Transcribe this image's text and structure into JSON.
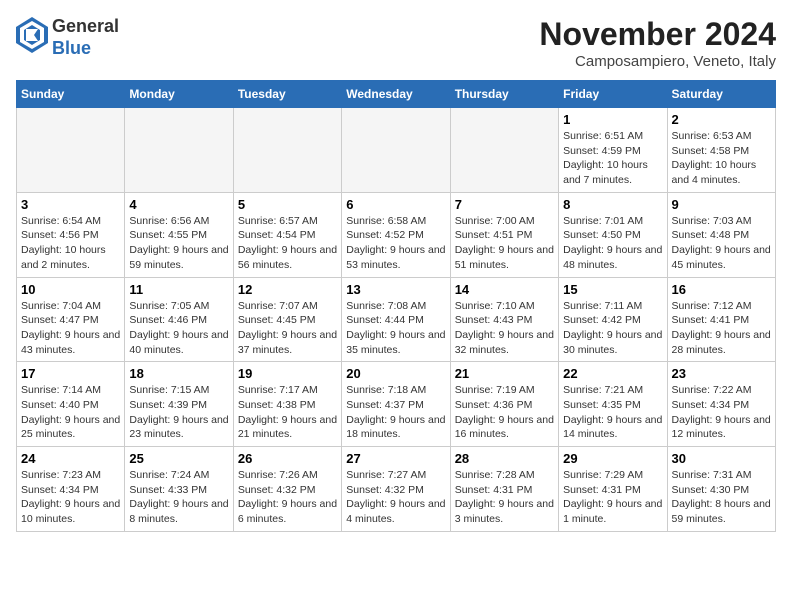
{
  "header": {
    "logo_line1": "General",
    "logo_line2": "Blue",
    "month_title": "November 2024",
    "location": "Camposampiero, Veneto, Italy"
  },
  "days_of_week": [
    "Sunday",
    "Monday",
    "Tuesday",
    "Wednesday",
    "Thursday",
    "Friday",
    "Saturday"
  ],
  "weeks": [
    [
      {
        "day": "",
        "info": ""
      },
      {
        "day": "",
        "info": ""
      },
      {
        "day": "",
        "info": ""
      },
      {
        "day": "",
        "info": ""
      },
      {
        "day": "",
        "info": ""
      },
      {
        "day": "1",
        "info": "Sunrise: 6:51 AM\nSunset: 4:59 PM\nDaylight: 10 hours and 7 minutes."
      },
      {
        "day": "2",
        "info": "Sunrise: 6:53 AM\nSunset: 4:58 PM\nDaylight: 10 hours and 4 minutes."
      }
    ],
    [
      {
        "day": "3",
        "info": "Sunrise: 6:54 AM\nSunset: 4:56 PM\nDaylight: 10 hours and 2 minutes."
      },
      {
        "day": "4",
        "info": "Sunrise: 6:56 AM\nSunset: 4:55 PM\nDaylight: 9 hours and 59 minutes."
      },
      {
        "day": "5",
        "info": "Sunrise: 6:57 AM\nSunset: 4:54 PM\nDaylight: 9 hours and 56 minutes."
      },
      {
        "day": "6",
        "info": "Sunrise: 6:58 AM\nSunset: 4:52 PM\nDaylight: 9 hours and 53 minutes."
      },
      {
        "day": "7",
        "info": "Sunrise: 7:00 AM\nSunset: 4:51 PM\nDaylight: 9 hours and 51 minutes."
      },
      {
        "day": "8",
        "info": "Sunrise: 7:01 AM\nSunset: 4:50 PM\nDaylight: 9 hours and 48 minutes."
      },
      {
        "day": "9",
        "info": "Sunrise: 7:03 AM\nSunset: 4:48 PM\nDaylight: 9 hours and 45 minutes."
      }
    ],
    [
      {
        "day": "10",
        "info": "Sunrise: 7:04 AM\nSunset: 4:47 PM\nDaylight: 9 hours and 43 minutes."
      },
      {
        "day": "11",
        "info": "Sunrise: 7:05 AM\nSunset: 4:46 PM\nDaylight: 9 hours and 40 minutes."
      },
      {
        "day": "12",
        "info": "Sunrise: 7:07 AM\nSunset: 4:45 PM\nDaylight: 9 hours and 37 minutes."
      },
      {
        "day": "13",
        "info": "Sunrise: 7:08 AM\nSunset: 4:44 PM\nDaylight: 9 hours and 35 minutes."
      },
      {
        "day": "14",
        "info": "Sunrise: 7:10 AM\nSunset: 4:43 PM\nDaylight: 9 hours and 32 minutes."
      },
      {
        "day": "15",
        "info": "Sunrise: 7:11 AM\nSunset: 4:42 PM\nDaylight: 9 hours and 30 minutes."
      },
      {
        "day": "16",
        "info": "Sunrise: 7:12 AM\nSunset: 4:41 PM\nDaylight: 9 hours and 28 minutes."
      }
    ],
    [
      {
        "day": "17",
        "info": "Sunrise: 7:14 AM\nSunset: 4:40 PM\nDaylight: 9 hours and 25 minutes."
      },
      {
        "day": "18",
        "info": "Sunrise: 7:15 AM\nSunset: 4:39 PM\nDaylight: 9 hours and 23 minutes."
      },
      {
        "day": "19",
        "info": "Sunrise: 7:17 AM\nSunset: 4:38 PM\nDaylight: 9 hours and 21 minutes."
      },
      {
        "day": "20",
        "info": "Sunrise: 7:18 AM\nSunset: 4:37 PM\nDaylight: 9 hours and 18 minutes."
      },
      {
        "day": "21",
        "info": "Sunrise: 7:19 AM\nSunset: 4:36 PM\nDaylight: 9 hours and 16 minutes."
      },
      {
        "day": "22",
        "info": "Sunrise: 7:21 AM\nSunset: 4:35 PM\nDaylight: 9 hours and 14 minutes."
      },
      {
        "day": "23",
        "info": "Sunrise: 7:22 AM\nSunset: 4:34 PM\nDaylight: 9 hours and 12 minutes."
      }
    ],
    [
      {
        "day": "24",
        "info": "Sunrise: 7:23 AM\nSunset: 4:34 PM\nDaylight: 9 hours and 10 minutes."
      },
      {
        "day": "25",
        "info": "Sunrise: 7:24 AM\nSunset: 4:33 PM\nDaylight: 9 hours and 8 minutes."
      },
      {
        "day": "26",
        "info": "Sunrise: 7:26 AM\nSunset: 4:32 PM\nDaylight: 9 hours and 6 minutes."
      },
      {
        "day": "27",
        "info": "Sunrise: 7:27 AM\nSunset: 4:32 PM\nDaylight: 9 hours and 4 minutes."
      },
      {
        "day": "28",
        "info": "Sunrise: 7:28 AM\nSunset: 4:31 PM\nDaylight: 9 hours and 3 minutes."
      },
      {
        "day": "29",
        "info": "Sunrise: 7:29 AM\nSunset: 4:31 PM\nDaylight: 9 hours and 1 minute."
      },
      {
        "day": "30",
        "info": "Sunrise: 7:31 AM\nSunset: 4:30 PM\nDaylight: 8 hours and 59 minutes."
      }
    ]
  ]
}
